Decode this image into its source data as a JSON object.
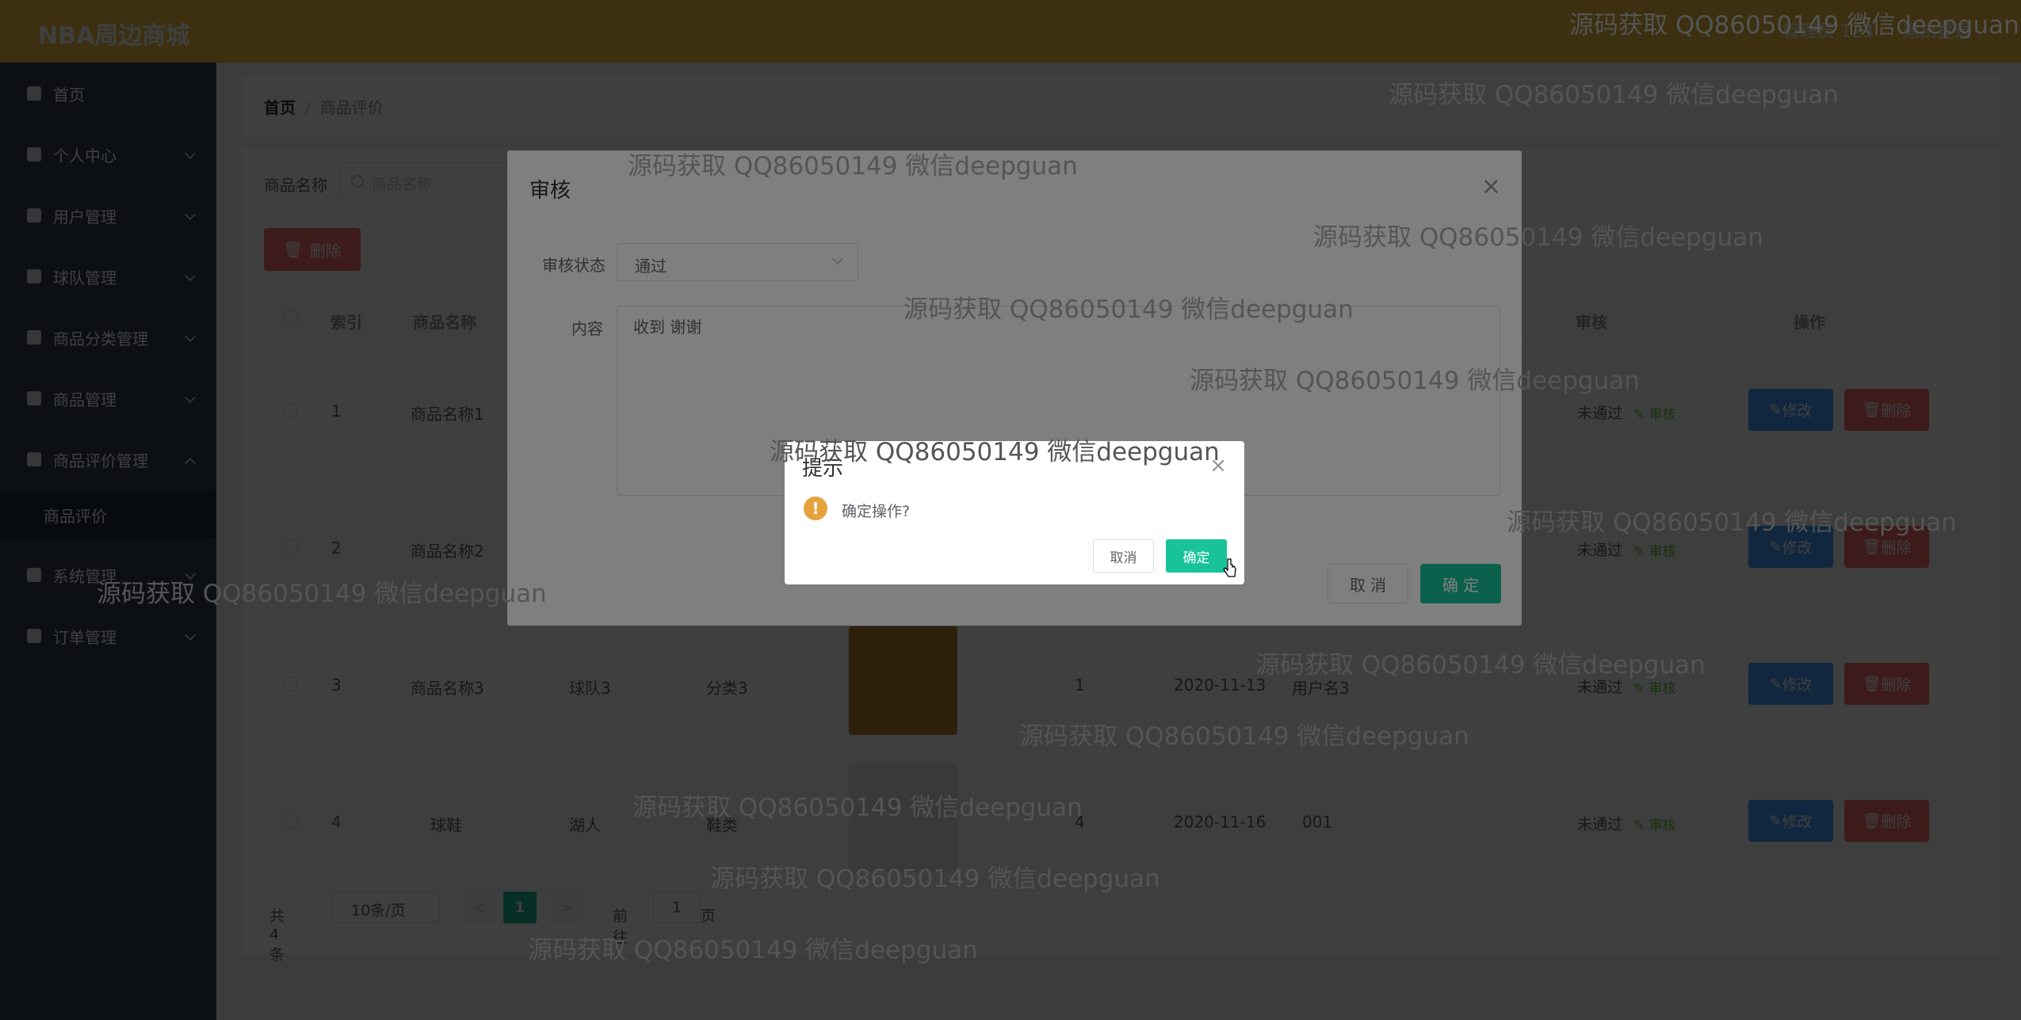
{
  "header": {
    "brand": "NBA周边商城",
    "user": "管理员 123",
    "logout": "退出登录"
  },
  "sidebar": {
    "items": [
      {
        "label": "首页",
        "icon": "home-icon"
      },
      {
        "label": "个人中心",
        "icon": "user-icon"
      },
      {
        "label": "用户管理",
        "icon": "user-management-icon"
      },
      {
        "label": "球队管理",
        "icon": "team-icon"
      },
      {
        "label": "商品分类管理",
        "icon": "category-icon"
      },
      {
        "label": "商品管理",
        "icon": "product-icon"
      },
      {
        "label": "商品评价管理",
        "icon": "review-icon",
        "expanded": true
      },
      {
        "label": "系统管理",
        "icon": "system-icon"
      },
      {
        "label": "订单管理",
        "icon": "order-icon"
      }
    ],
    "sub_item": "商品评价"
  },
  "breadcrumb": {
    "home": "首页",
    "current": "商品评价"
  },
  "search": {
    "label": "商品名称",
    "placeholder": "商品名称"
  },
  "toolbar": {
    "delete_label": "删除"
  },
  "table": {
    "headers": [
      "索引",
      "商品名称",
      "审核",
      "操作"
    ],
    "rows": [
      {
        "index": "1",
        "name": "商品名称1",
        "team": "",
        "category": "",
        "qty": "",
        "date": "",
        "user": "",
        "status": "未通过",
        "audit": "审核",
        "img": "#c9b27a"
      },
      {
        "index": "2",
        "name": "商品名称2",
        "team": "",
        "category": "",
        "qty": "",
        "date": "",
        "user": "",
        "status": "未通过",
        "audit": "审核",
        "img": "#a7774a"
      },
      {
        "index": "3",
        "name": "商品名称3",
        "team": "球队3",
        "category": "分类3",
        "qty": "1",
        "date": "2020-11-13",
        "user": "用户名3",
        "status": "未通过",
        "audit": "审核",
        "img": "#b8862e"
      },
      {
        "index": "4",
        "name": "球鞋",
        "team": "湖人",
        "category": "鞋类",
        "qty": "4",
        "date": "2020-11-16",
        "user": "001",
        "status": "未通过",
        "audit": "审核",
        "img": "#d9d9d9"
      }
    ],
    "edit_label": "修改",
    "delete_label": "删除"
  },
  "pagination": {
    "total": "共 4 条",
    "page_size": "10条/页",
    "prev": "<",
    "page": "1",
    "next": ">",
    "goto": "前往",
    "goto_value": "1",
    "page_unit": "页"
  },
  "audit_dialog": {
    "title": "审核",
    "status_label": "审核状态",
    "status_value": "通过",
    "content_label": "内容",
    "content_value": "收到 谢谢",
    "cancel": "取 消",
    "confirm": "确 定"
  },
  "confirm_box": {
    "title": "提示",
    "message": "确定操作?",
    "cancel": "取消",
    "confirm": "确定"
  },
  "watermark": "源码获取 QQ86050149 微信deepguan"
}
